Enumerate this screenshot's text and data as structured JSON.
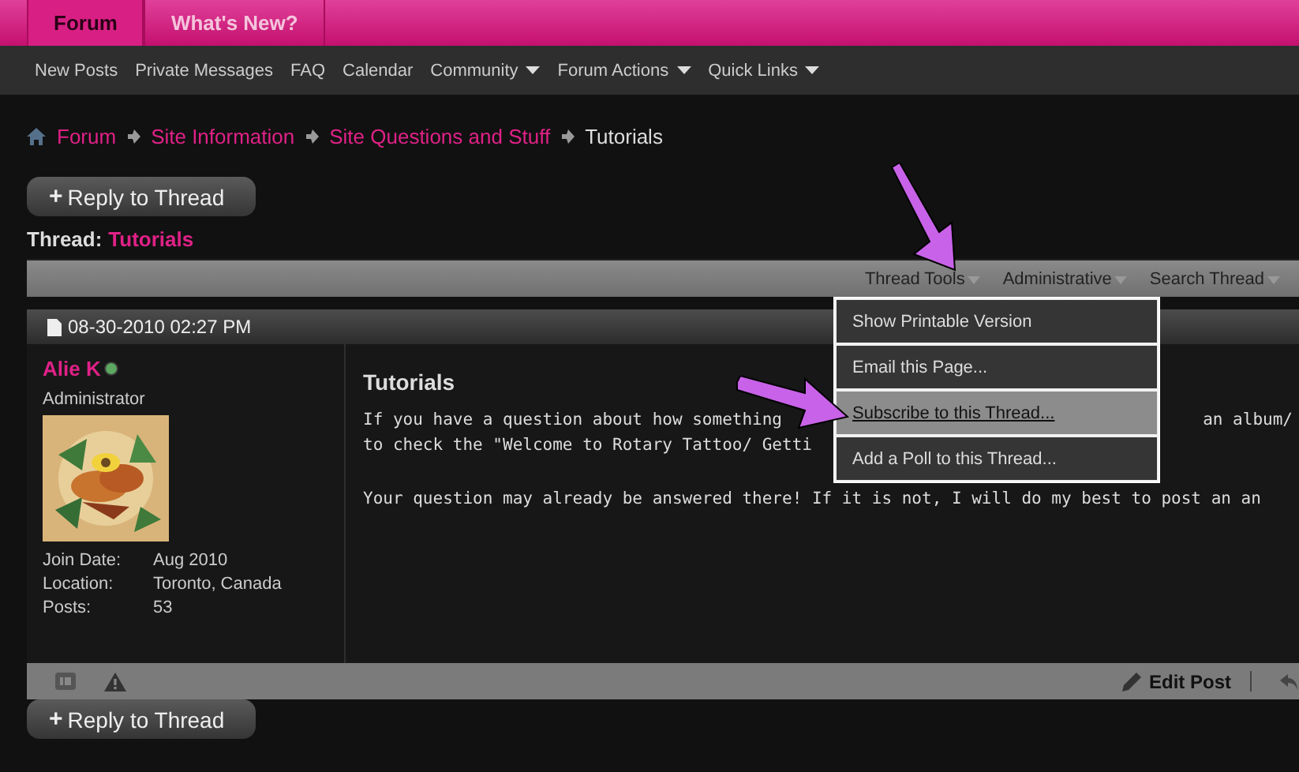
{
  "tabs": [
    {
      "label": "Forum",
      "selected": true
    },
    {
      "label": "What's New?",
      "selected": false
    }
  ],
  "nav": [
    {
      "label": "New Posts",
      "has_menu": false
    },
    {
      "label": "Private Messages",
      "has_menu": false
    },
    {
      "label": "FAQ",
      "has_menu": false
    },
    {
      "label": "Calendar",
      "has_menu": false
    },
    {
      "label": "Community",
      "has_menu": true
    },
    {
      "label": "Forum Actions",
      "has_menu": true
    },
    {
      "label": "Quick Links",
      "has_menu": true
    }
  ],
  "breadcrumb": [
    {
      "label": "Forum",
      "current": false
    },
    {
      "label": "Site Information",
      "current": false
    },
    {
      "label": "Site Questions and Stuff",
      "current": false
    },
    {
      "label": "Tutorials",
      "current": true
    }
  ],
  "reply_button_top": {
    "icon": "+",
    "label": "Reply to Thread"
  },
  "thread": {
    "label": "Thread:",
    "title": "Tutorials"
  },
  "thread_toolbar": [
    "Thread Tools",
    "Administrative",
    "Search Thread"
  ],
  "thread_tools_menu": [
    {
      "label": "Show Printable Version",
      "selected": false
    },
    {
      "label": "Email this Page...",
      "selected": false
    },
    {
      "label": "Subscribe to this Thread...",
      "selected": true
    },
    {
      "label": "Add a Poll to this Thread...",
      "selected": false
    }
  ],
  "post": {
    "date": "08-30-2010 02:27 PM",
    "author": {
      "name": "Alie K",
      "online": true,
      "rank": "Administrator",
      "details": [
        {
          "label": "Join Date:",
          "value": "Aug 2010"
        },
        {
          "label": "Location:",
          "value": "Toronto, Canada"
        },
        {
          "label": "Posts:",
          "value": "53"
        }
      ]
    },
    "title": "Tutorials",
    "paragraphs": [
      [
        [
          "If you have a question about how something",
          "an album/"
        ],
        [
          "to check the \"Welcome to Rotary Tattoo/ Getti"
        ]
      ],
      [
        [
          "Your question may already be answered there! If it is not, I will do my best to post an an"
        ]
      ]
    ],
    "edit_button": "Edit Post"
  },
  "reply_button_bottom": {
    "icon": "+",
    "label": "Reply to Thread"
  }
}
